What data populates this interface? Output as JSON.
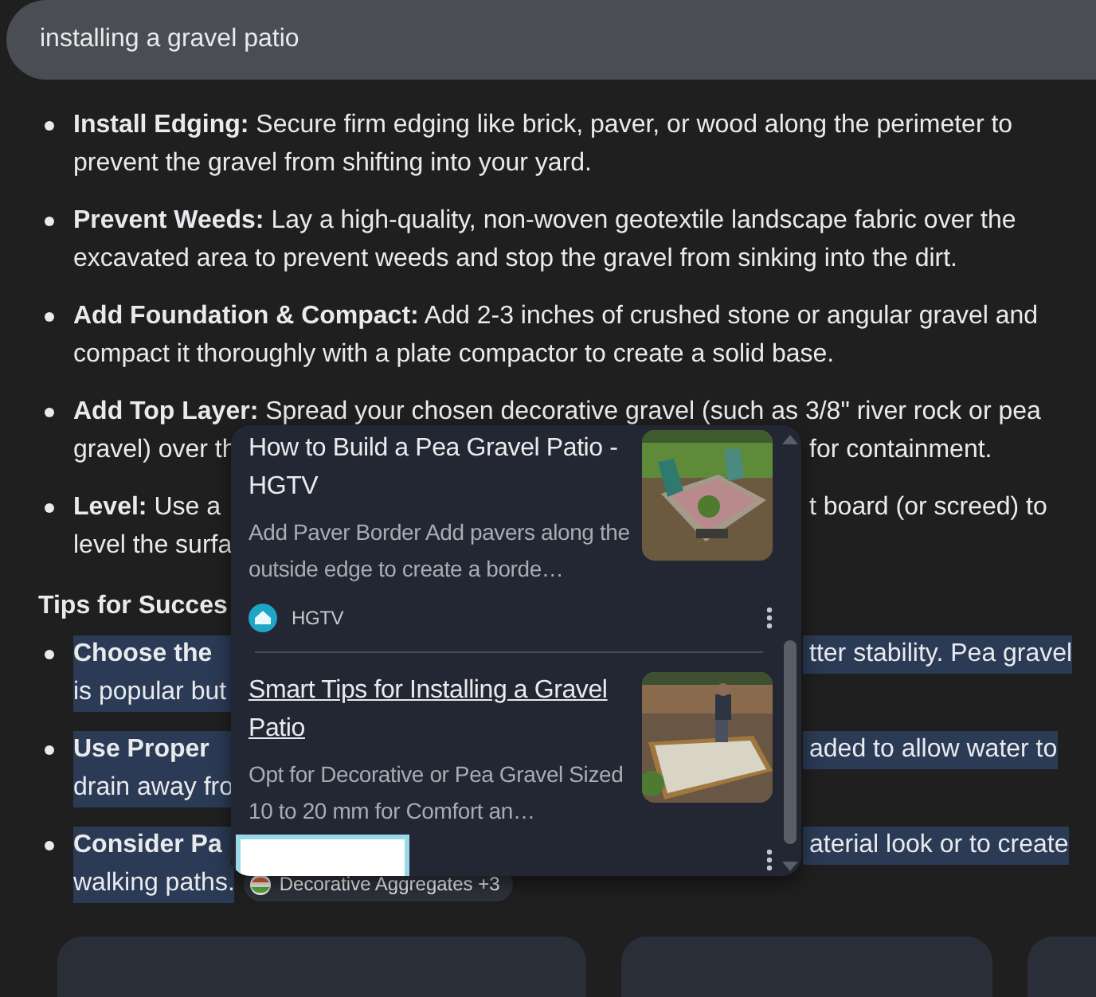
{
  "search": {
    "query": "installing a gravel patio"
  },
  "steps": [
    {
      "lines": [
        "**Install Edging:** Secure firm edging like brick, paver, or wood along the perimeter to",
        "prevent the gravel from shifting into your yard."
      ]
    },
    {
      "lines": [
        "**Prevent Weeds:** Lay a high-quality, non-woven geotextile landscape fabric over the",
        "excavated area to prevent weeds and stop the gravel from sinking into the dirt."
      ]
    },
    {
      "lines": [
        "**Add Foundation & Compact:** Add 2-3 inches of crushed stone or angular gravel and",
        "compact it thoroughly with a plate compactor to create a solid base."
      ]
    },
    {
      "lines": [
        "**Add Top Layer:** Spread your chosen decorative gravel (such as 3/8\" river rock or pea",
        {
          "left": "gravel) over th",
          "right": "for containment."
        }
      ]
    },
    {
      "lines": [
        {
          "left": "**Level:** Use a",
          "right": "t board (or screed) to"
        },
        {
          "left": "level the surfa"
        }
      ]
    }
  ],
  "tips": {
    "heading": "Tips for Succes",
    "items": [
      {
        "highlighted": true,
        "lines": [
          {
            "left": "**Choose the**",
            "right": "tter stability. Pea gravel"
          },
          {
            "left": "is popular but"
          }
        ]
      },
      {
        "highlighted": true,
        "lines": [
          {
            "left": "**Use Proper**",
            "right": "aded to allow water to"
          },
          {
            "left": "drain away fro"
          }
        ]
      },
      {
        "highlighted": true,
        "lines": [
          {
            "left": "**Consider Pa**",
            "right": "aterial look or to create"
          },
          "walking paths."
        ],
        "source_chip": "Decorative Aggregates +3"
      }
    ]
  },
  "popup": {
    "cards": [
      {
        "title": "How to Build a Pea Gravel Patio - HGTV",
        "underlined": false,
        "snippet": "Add Paver Border Add pavers along the outside edge to create a borde…",
        "source": "HGTV"
      },
      {
        "title": "Smart Tips for Installing a Gravel Patio",
        "underlined": true,
        "snippet": "Opt for Decorative or Pea Gravel Sized 10 to 20 mm for Comfort an…"
      }
    ]
  }
}
